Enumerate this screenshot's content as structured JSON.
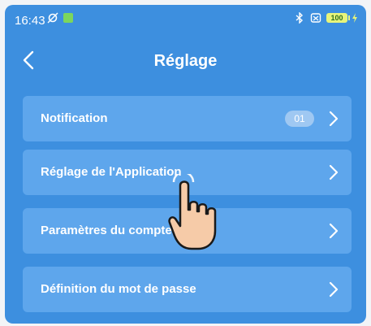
{
  "statusbar": {
    "time": "16:43",
    "battery": "100"
  },
  "header": {
    "title": "Réglage"
  },
  "menu": [
    {
      "label": "Notification",
      "badge": "01"
    },
    {
      "label": "Réglage de l'Application"
    },
    {
      "label": "Paramètres du compte"
    },
    {
      "label": "Définition du mot de passe"
    }
  ],
  "colors": {
    "background": "#3d8fdf",
    "item": "#5ea6ec",
    "text": "#ffffff"
  },
  "icons": [
    "back-arrow-icon",
    "chevron-right-icon",
    "pointing-hand-icon",
    "bluetooth-icon",
    "battery-icon"
  ]
}
